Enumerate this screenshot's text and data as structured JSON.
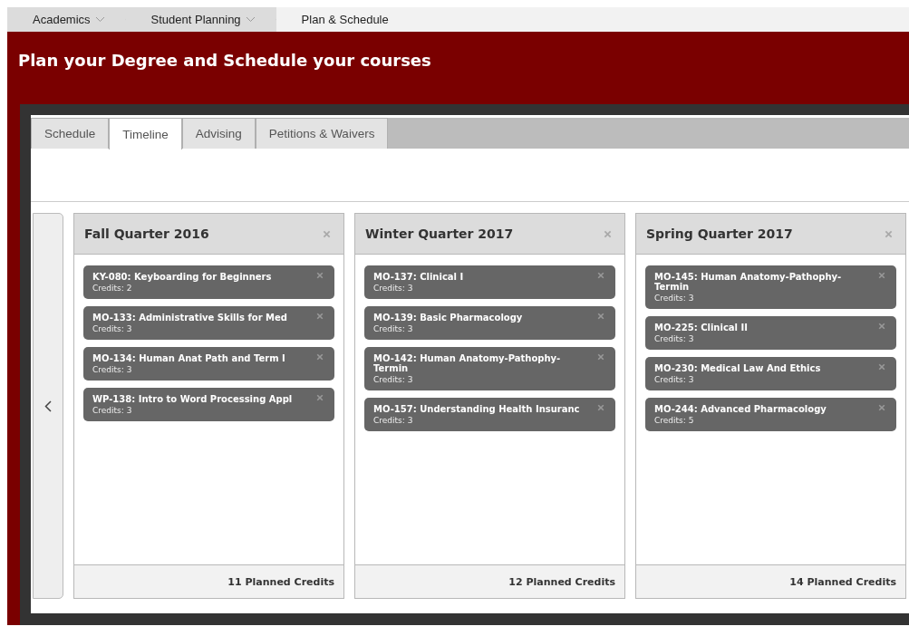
{
  "breadcrumbs": [
    {
      "label": "Academics",
      "dropdown": true
    },
    {
      "label": "Student Planning",
      "dropdown": true
    },
    {
      "label": "Plan & Schedule",
      "dropdown": false
    }
  ],
  "page_title": "Plan your Degree and Schedule your courses",
  "tabs": [
    {
      "label": "Schedule",
      "selected": false
    },
    {
      "label": "Timeline",
      "selected": true
    },
    {
      "label": "Advising",
      "selected": false
    },
    {
      "label": "Petitions & Waivers",
      "selected": false
    }
  ],
  "terms": [
    {
      "title": "Fall Quarter 2016",
      "footer": "11 Planned Credits",
      "courses": [
        {
          "title": "KY-080: Keyboarding for Beginners",
          "credits": "Credits: 2"
        },
        {
          "title": "MO-133: Administrative Skills for Med",
          "credits": "Credits: 3"
        },
        {
          "title": "MO-134: Human Anat Path and Term I",
          "credits": "Credits: 3"
        },
        {
          "title": "WP-138: Intro to Word Processing Appl",
          "credits": "Credits: 3"
        }
      ]
    },
    {
      "title": "Winter Quarter 2017",
      "footer": "12 Planned Credits",
      "courses": [
        {
          "title": "MO-137: Clinical I",
          "credits": "Credits: 3"
        },
        {
          "title": "MO-139: Basic Pharmacology",
          "credits": "Credits: 3"
        },
        {
          "title": "MO-142: Human Anatomy-Pathophy-Termin",
          "credits": "Credits: 3"
        },
        {
          "title": "MO-157: Understanding Health Insuranc",
          "credits": "Credits: 3"
        }
      ]
    },
    {
      "title": "Spring Quarter 2017",
      "footer": "14 Planned Credits",
      "courses": [
        {
          "title": "MO-145: Human Anatomy-Pathophy-Termin",
          "credits": "Credits: 3"
        },
        {
          "title": "MO-225: Clinical II",
          "credits": "Credits: 3"
        },
        {
          "title": "MO-230: Medical Law And Ethics",
          "credits": "Credits: 3"
        },
        {
          "title": "MO-244: Advanced Pharmacology",
          "credits": "Credits: 5"
        }
      ]
    }
  ]
}
